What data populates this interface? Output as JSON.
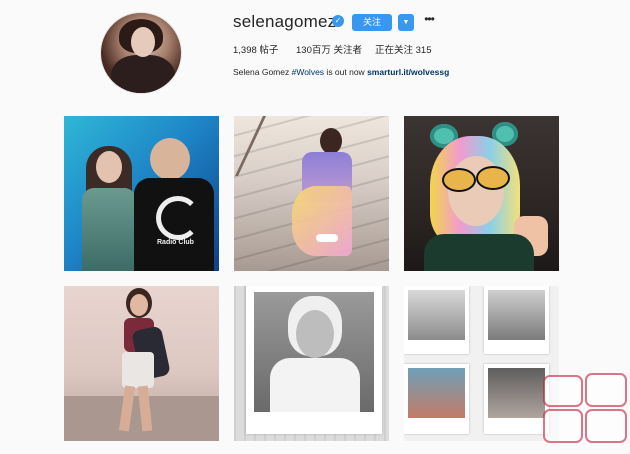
{
  "profile": {
    "username": "selenagomez",
    "verified_badge": "✓",
    "follow_label": "关注",
    "dropdown_icon": "▼",
    "more_icon": "•••",
    "stats": {
      "posts": "1,398 帖子",
      "followers": "130百万 关注者",
      "following": "正在关注 315"
    },
    "bio": {
      "name": "Selena Gomez",
      "hashtag": "#Wolves",
      "text": " is out now ",
      "link": "smarturl.it/wolvessg"
    }
  },
  "posts": {
    "tile1_text": "Radio Club"
  }
}
